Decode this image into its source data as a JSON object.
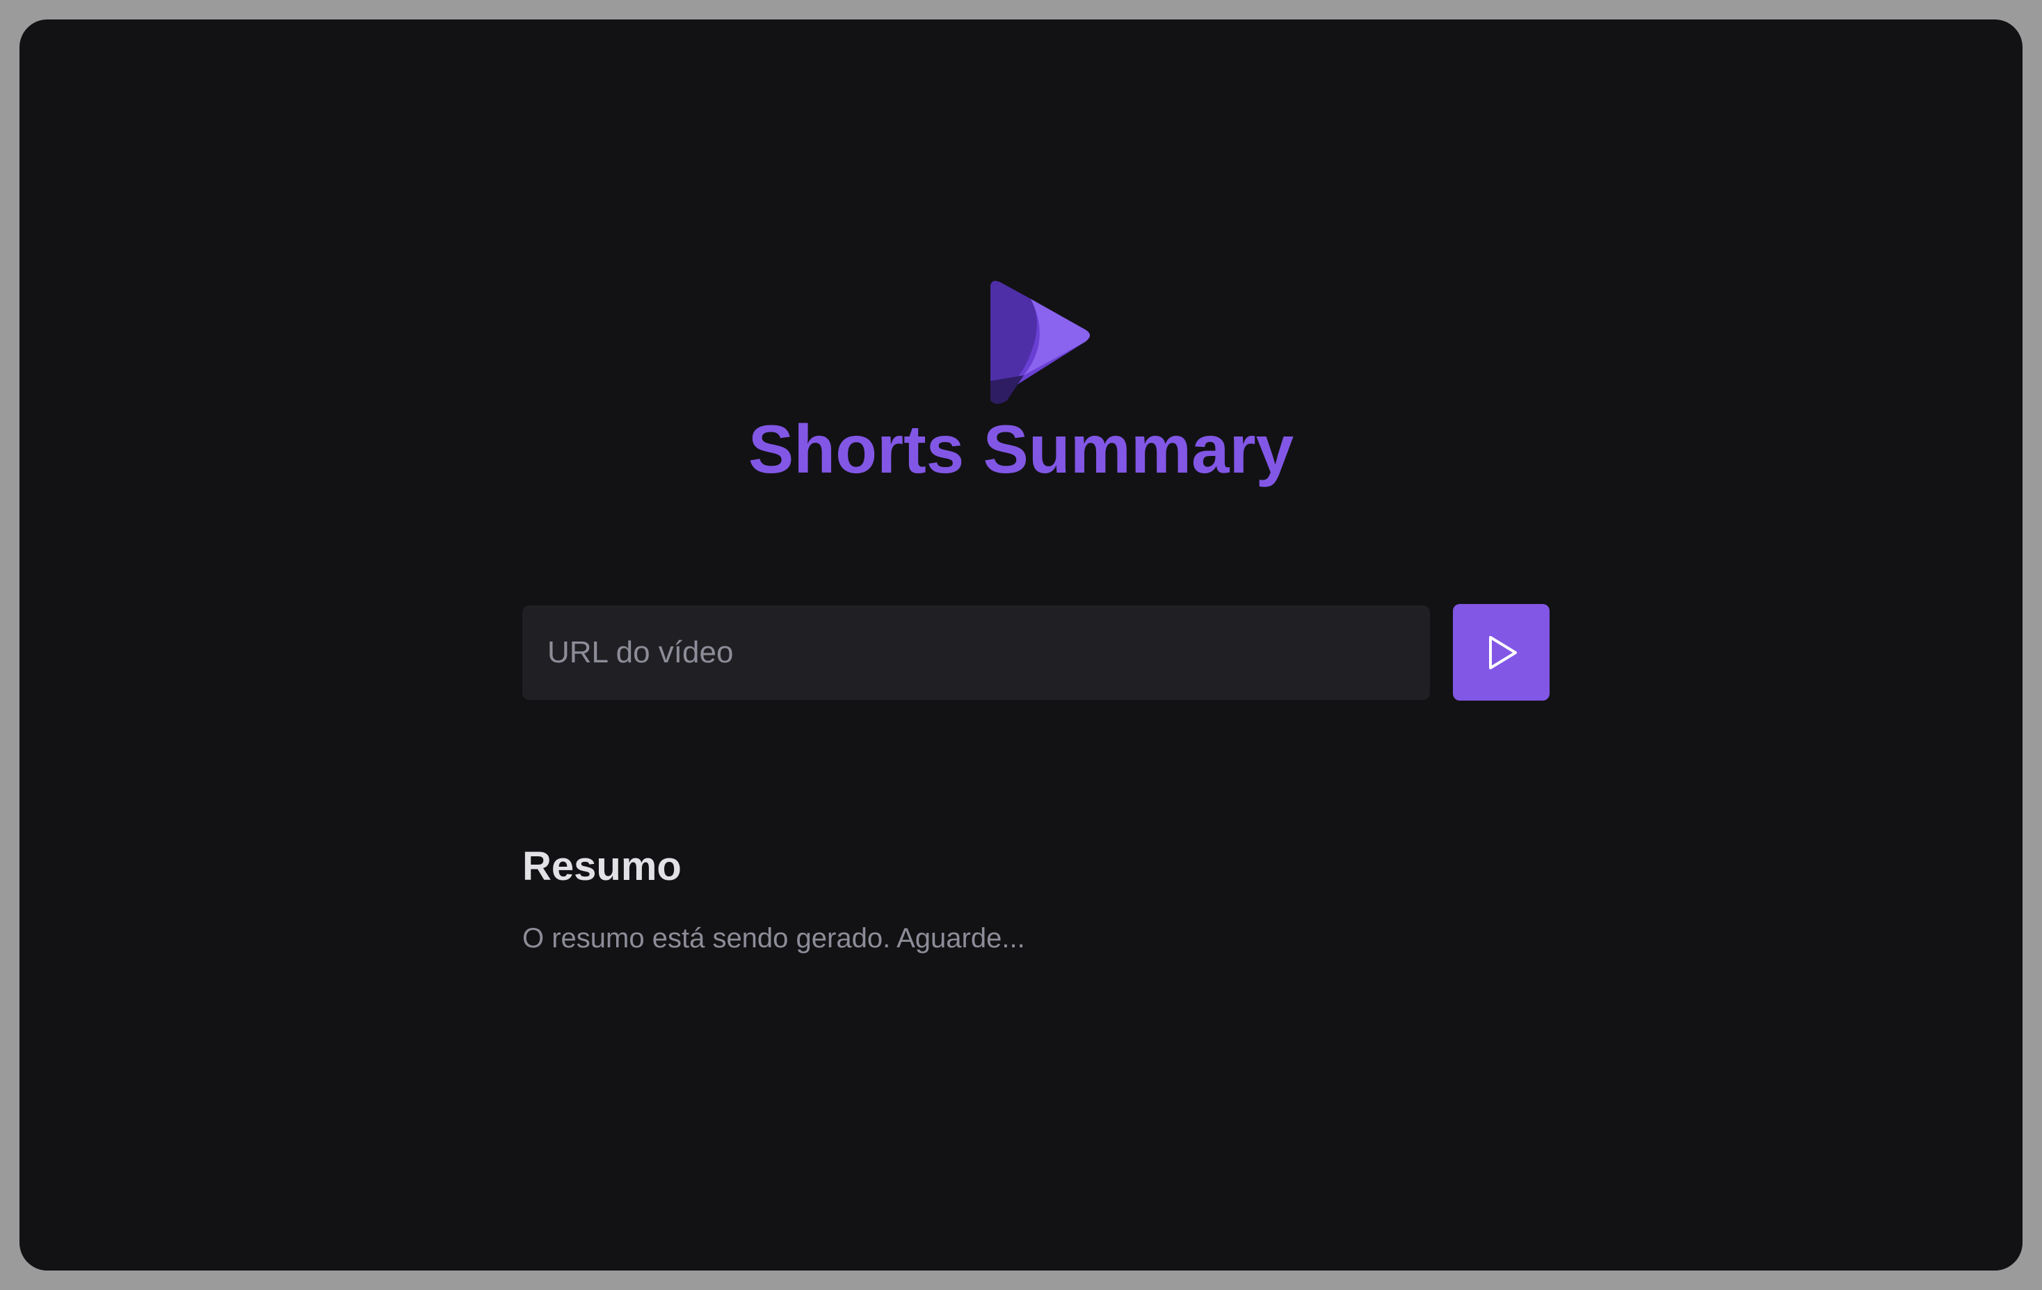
{
  "app": {
    "title": "Shorts Summary",
    "logo_icon": "play-logo-icon"
  },
  "search": {
    "placeholder": "URL do vídeo",
    "value": "",
    "submit_icon": "play-icon"
  },
  "summary": {
    "heading": "Resumo",
    "status_text": "O resumo está sendo gerado. Aguarde..."
  },
  "colors": {
    "background": "#121214",
    "frame": "#9b9b9b",
    "input_background": "#202024",
    "accent": "#8257e5",
    "title": "#8257e5",
    "heading_text": "#e1e1e6",
    "muted_text": "#8d8d99"
  }
}
